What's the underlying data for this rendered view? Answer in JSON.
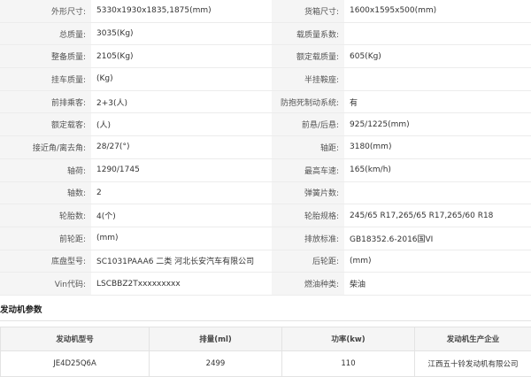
{
  "specs": {
    "rows": [
      {
        "l_label": "外形尺寸:",
        "l_value": "5330x1930x1835,1875(mm)",
        "r_label": "货箱尺寸:",
        "r_value": "1600x1595x500(mm)"
      },
      {
        "l_label": "总质量:",
        "l_value": "3035(Kg)",
        "r_label": "载质量系数:",
        "r_value": ""
      },
      {
        "l_label": "整备质量:",
        "l_value": "2105(Kg)",
        "r_label": "额定载质量:",
        "r_value": "605(Kg)"
      },
      {
        "l_label": "挂车质量:",
        "l_value": "(Kg)",
        "r_label": "半挂鞍座:",
        "r_value": ""
      },
      {
        "l_label": "前排乘客:",
        "l_value": "2+3(人)",
        "r_label": "防抱死制动系统:",
        "r_value": "有"
      },
      {
        "l_label": "额定载客:",
        "l_value": "(人)",
        "r_label": "前悬/后悬:",
        "r_value": "925/1225(mm)"
      },
      {
        "l_label": "接近角/离去角:",
        "l_value": "28/27(°)",
        "r_label": "轴距:",
        "r_value": "3180(mm)"
      },
      {
        "l_label": "轴荷:",
        "l_value": "1290/1745",
        "r_label": "最高车速:",
        "r_value": "165(km/h)"
      },
      {
        "l_label": "轴数:",
        "l_value": "2",
        "r_label": "弹簧片数:",
        "r_value": ""
      },
      {
        "l_label": "轮胎数:",
        "l_value": "4(个)",
        "r_label": "轮胎规格:",
        "r_value": "245/65 R17,265/65 R17,265/60 R18"
      },
      {
        "l_label": "前轮距:",
        "l_value": "(mm)",
        "r_label": "排放标准:",
        "r_value": "GB18352.6-2016国VI"
      },
      {
        "l_label": "底盘型号:",
        "l_value": "SC1031PAAA6 二类 河北长安汽车有限公司",
        "r_label": "后轮距:",
        "r_value": "(mm)"
      },
      {
        "l_label": "Vin代码:",
        "l_value": "LSCBBZ2Txxxxxxxxx",
        "r_label": "燃油种类:",
        "r_value": "柴油"
      }
    ]
  },
  "engine": {
    "title": "发动机参数",
    "headers": [
      "发动机型号",
      "排量(ml)",
      "功率(kw)",
      "发动机生产企业"
    ],
    "rows": [
      [
        "JE4D25Q6A",
        "2499",
        "110",
        "江西五十铃发动机有限公司"
      ]
    ]
  }
}
